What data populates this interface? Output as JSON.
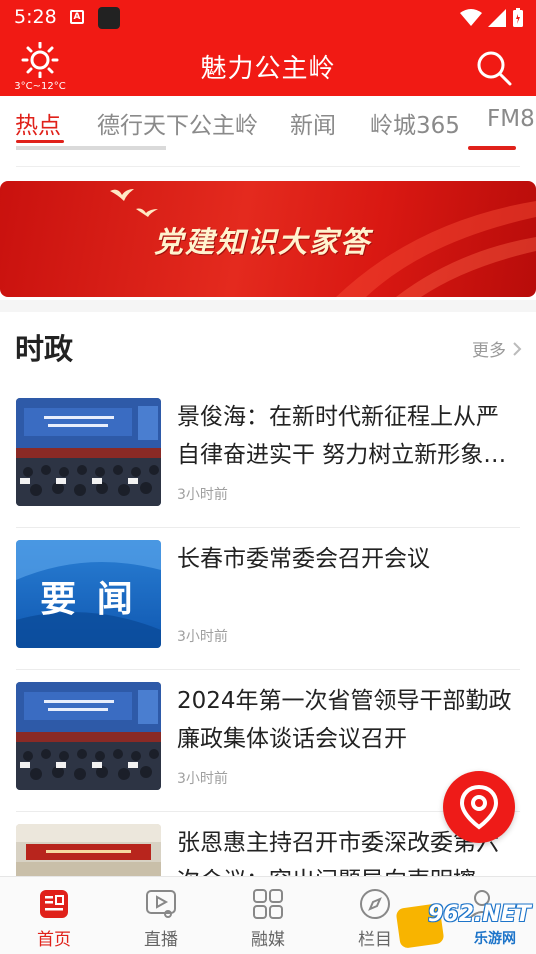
{
  "status_bar": {
    "time": "5:28",
    "a_badge": "A"
  },
  "header": {
    "title": "魅力公主岭",
    "weather_temp": "3°C~12°C",
    "weather_icon": "sun-icon",
    "search_icon": "search-icon"
  },
  "tabs": [
    {
      "label": "热点",
      "active": true
    },
    {
      "label": "德行天下公主岭",
      "active": false
    },
    {
      "label": "新闻",
      "active": false
    },
    {
      "label": "岭城365",
      "active": false
    },
    {
      "label": "FM8",
      "active": false
    }
  ],
  "banner": {
    "text": "党建知识大家答"
  },
  "section": {
    "title": "时政",
    "more_label": "更多"
  },
  "news": [
    {
      "title": "景俊海：在新时代新征程上从严自律奋进实干 努力树立新形象…",
      "time": "3小时前",
      "thumb": "meeting-photo"
    },
    {
      "title": "长春市委常委会召开会议",
      "time": "3小时前",
      "thumb": "yaowen-graphic",
      "thumb_text": "要 闻"
    },
    {
      "title": "2024年第一次省管领导干部勤政廉政集体谈话会议召开",
      "time": "3小时前",
      "thumb": "meeting-photo"
    },
    {
      "title": "张恩惠主持召开市委深改委第六次会议：突出问题导向声明擦",
      "time": "",
      "thumb": "hall-photo"
    }
  ],
  "bottom_nav": [
    {
      "label": "首页",
      "icon": "home-news-icon",
      "active": true
    },
    {
      "label": "直播",
      "icon": "live-video-icon",
      "active": false
    },
    {
      "label": "融媒",
      "icon": "grid-icon",
      "active": false
    },
    {
      "label": "栏目",
      "icon": "compass-icon",
      "active": false
    },
    {
      "label": "",
      "icon": "user-icon",
      "active": false
    }
  ],
  "colors": {
    "brand_red": "#f11a14",
    "active_red": "#e0211a"
  },
  "watermark": {
    "text": "962.NET",
    "subtext": "乐游网"
  }
}
